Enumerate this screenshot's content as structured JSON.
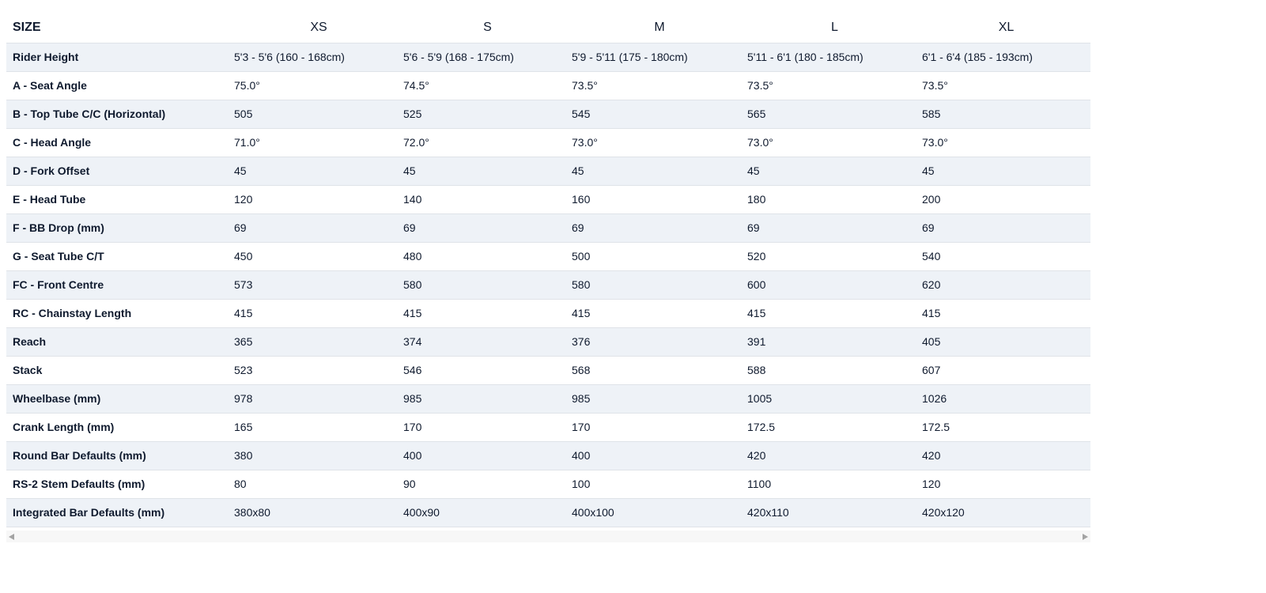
{
  "table": {
    "header_label": "SIZE",
    "sizes": [
      "XS",
      "S",
      "M",
      "L",
      "XL"
    ],
    "rows": [
      {
        "label": "Rider Height",
        "values": [
          "5'3 - 5'6 (160 - 168cm)",
          "5'6 - 5'9 (168 - 175cm)",
          "5'9 - 5'11 (175 - 180cm)",
          "5'11 - 6'1 (180 - 185cm)",
          "6'1 - 6'4 (185 - 193cm)"
        ]
      },
      {
        "label": "A - Seat Angle",
        "values": [
          "75.0°",
          "74.5°",
          "73.5°",
          "73.5°",
          "73.5°"
        ]
      },
      {
        "label": "B - Top Tube C/C (Horizontal)",
        "values": [
          "505",
          "525",
          "545",
          "565",
          "585"
        ]
      },
      {
        "label": "C - Head Angle",
        "values": [
          "71.0°",
          "72.0°",
          "73.0°",
          "73.0°",
          "73.0°"
        ]
      },
      {
        "label": "D - Fork Offset",
        "values": [
          "45",
          "45",
          "45",
          "45",
          "45"
        ]
      },
      {
        "label": "E - Head Tube",
        "values": [
          "120",
          "140",
          "160",
          "180",
          "200"
        ]
      },
      {
        "label": "F - BB Drop (mm)",
        "values": [
          "69",
          "69",
          "69",
          "69",
          "69"
        ]
      },
      {
        "label": "G - Seat Tube C/T",
        "values": [
          "450",
          "480",
          "500",
          "520",
          "540"
        ]
      },
      {
        "label": "FC - Front Centre",
        "values": [
          "573",
          "580",
          "580",
          "600",
          "620"
        ]
      },
      {
        "label": "RC - Chainstay Length",
        "values": [
          "415",
          "415",
          "415",
          "415",
          "415"
        ]
      },
      {
        "label": "Reach",
        "values": [
          "365",
          "374",
          "376",
          "391",
          "405"
        ]
      },
      {
        "label": "Stack",
        "values": [
          "523",
          "546",
          "568",
          "588",
          "607"
        ]
      },
      {
        "label": "Wheelbase (mm)",
        "values": [
          "978",
          "985",
          "985",
          "1005",
          "1026"
        ]
      },
      {
        "label": "Crank Length (mm)",
        "values": [
          "165",
          "170",
          "170",
          "172.5",
          "172.5"
        ]
      },
      {
        "label": "Round Bar Defaults (mm)",
        "values": [
          "380",
          "400",
          "400",
          "420",
          "420"
        ]
      },
      {
        "label": "RS-2 Stem Defaults (mm)",
        "values": [
          "80",
          "90",
          "100",
          "1100",
          "120"
        ]
      },
      {
        "label": "Integrated Bar Defaults (mm)",
        "values": [
          "380x80",
          "400x90",
          "400x100",
          "420x110",
          "420x120"
        ]
      }
    ]
  },
  "scrollbar": {
    "left_icon": "scroll-left-arrow-icon",
    "right_icon": "scroll-right-arrow-icon"
  },
  "colors": {
    "stripe": "#eef2f7",
    "text": "#0f1a2e",
    "divider": "#dfe3e8"
  }
}
